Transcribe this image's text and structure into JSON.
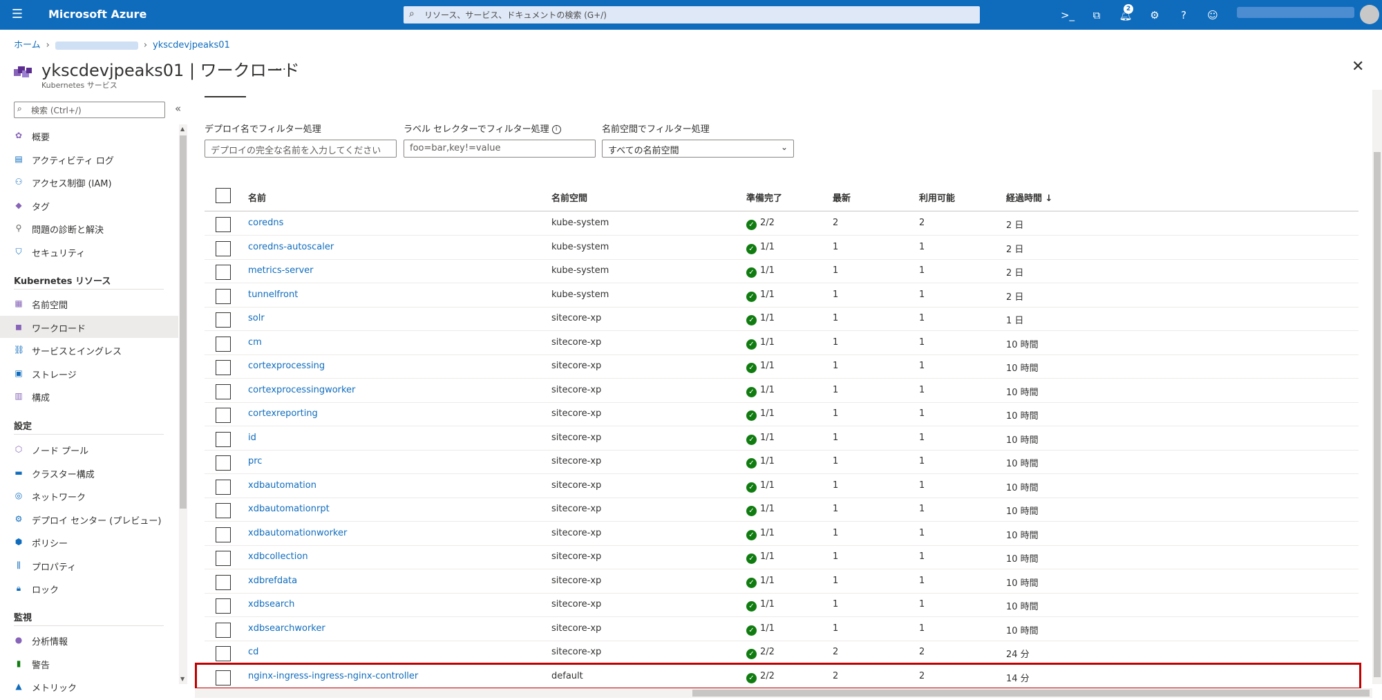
{
  "topbar": {
    "brand": "Microsoft Azure",
    "search_placeholder": "リソース、サービス、ドキュメントの検索 (G+/)",
    "notification_count": "2"
  },
  "breadcrumb": {
    "home": "ホーム",
    "current": "ykscdevjpeaks01"
  },
  "header": {
    "title": "ykscdevjpeaks01 | ワークロード",
    "subtitle": "Kubernetes サービス",
    "more": "…",
    "close": "✕"
  },
  "sidebar": {
    "search_placeholder": "検索 (Ctrl+/)",
    "collapse": "«",
    "items_top": [
      {
        "label": "概要",
        "icon": "overview-icon",
        "color": "#8764b8"
      },
      {
        "label": "アクティビティ ログ",
        "icon": "activity-log-icon",
        "color": "#0f6cbd"
      },
      {
        "label": "アクセス制御 (IAM)",
        "icon": "iam-icon",
        "color": "#0f6cbd"
      },
      {
        "label": "タグ",
        "icon": "tag-icon",
        "color": "#8764b8"
      },
      {
        "label": "問題の診断と解決",
        "icon": "wrench-icon",
        "color": "#605e5c"
      },
      {
        "label": "セキュリティ",
        "icon": "shield-icon",
        "color": "#0f6cbd"
      }
    ],
    "section_k8s": "Kubernetes リソース",
    "items_k8s": [
      {
        "label": "名前空間",
        "icon": "namespace-icon",
        "color": "#8764b8"
      },
      {
        "label": "ワークロード",
        "icon": "workload-icon",
        "color": "#8764b8",
        "selected": true
      },
      {
        "label": "サービスとイングレス",
        "icon": "services-icon",
        "color": "#0f6cbd"
      },
      {
        "label": "ストレージ",
        "icon": "storage-icon",
        "color": "#0f6cbd"
      },
      {
        "label": "構成",
        "icon": "config-icon",
        "color": "#8764b8"
      }
    ],
    "section_settings": "設定",
    "items_settings": [
      {
        "label": "ノード プール",
        "icon": "node-pool-icon",
        "color": "#8764b8"
      },
      {
        "label": "クラスター構成",
        "icon": "cluster-config-icon",
        "color": "#0f6cbd"
      },
      {
        "label": "ネットワーク",
        "icon": "network-icon",
        "color": "#0f6cbd"
      },
      {
        "label": "デプロイ センター (プレビュー)",
        "icon": "deploy-center-icon",
        "color": "#0f6cbd"
      },
      {
        "label": "ポリシー",
        "icon": "policy-icon",
        "color": "#0f6cbd"
      },
      {
        "label": "プロパティ",
        "icon": "properties-icon",
        "color": "#0f6cbd"
      },
      {
        "label": "ロック",
        "icon": "lock-icon",
        "color": "#0f6cbd"
      }
    ],
    "section_monitor": "監視",
    "items_monitor": [
      {
        "label": "分析情報",
        "icon": "insights-icon",
        "color": "#8764b8"
      },
      {
        "label": "警告",
        "icon": "alerts-icon",
        "color": "#107c10"
      },
      {
        "label": "メトリック",
        "icon": "metrics-icon",
        "color": "#0f6cbd"
      }
    ]
  },
  "filters": {
    "deploy_label": "デプロイ名でフィルター処理",
    "deploy_placeholder": "デプロイの完全な名前を入力してください",
    "label_label": "ラベル セレクターでフィルター処理",
    "label_placeholder": "foo=bar,key!=value",
    "ns_label": "名前空間でフィルター処理",
    "ns_value": "すべての名前空間"
  },
  "table": {
    "headers": {
      "name": "名前",
      "namespace": "名前空間",
      "ready": "準備完了",
      "latest": "最新",
      "available": "利用可能",
      "age": "経過時間 ↓"
    },
    "rows": [
      {
        "name": "coredns",
        "namespace": "kube-system",
        "ready": "2/2",
        "latest": "2",
        "available": "2",
        "age": "2 日"
      },
      {
        "name": "coredns-autoscaler",
        "namespace": "kube-system",
        "ready": "1/1",
        "latest": "1",
        "available": "1",
        "age": "2 日"
      },
      {
        "name": "metrics-server",
        "namespace": "kube-system",
        "ready": "1/1",
        "latest": "1",
        "available": "1",
        "age": "2 日"
      },
      {
        "name": "tunnelfront",
        "namespace": "kube-system",
        "ready": "1/1",
        "latest": "1",
        "available": "1",
        "age": "2 日"
      },
      {
        "name": "solr",
        "namespace": "sitecore-xp",
        "ready": "1/1",
        "latest": "1",
        "available": "1",
        "age": "1 日"
      },
      {
        "name": "cm",
        "namespace": "sitecore-xp",
        "ready": "1/1",
        "latest": "1",
        "available": "1",
        "age": "10 時間"
      },
      {
        "name": "cortexprocessing",
        "namespace": "sitecore-xp",
        "ready": "1/1",
        "latest": "1",
        "available": "1",
        "age": "10 時間"
      },
      {
        "name": "cortexprocessingworker",
        "namespace": "sitecore-xp",
        "ready": "1/1",
        "latest": "1",
        "available": "1",
        "age": "10 時間"
      },
      {
        "name": "cortexreporting",
        "namespace": "sitecore-xp",
        "ready": "1/1",
        "latest": "1",
        "available": "1",
        "age": "10 時間"
      },
      {
        "name": "id",
        "namespace": "sitecore-xp",
        "ready": "1/1",
        "latest": "1",
        "available": "1",
        "age": "10 時間"
      },
      {
        "name": "prc",
        "namespace": "sitecore-xp",
        "ready": "1/1",
        "latest": "1",
        "available": "1",
        "age": "10 時間"
      },
      {
        "name": "xdbautomation",
        "namespace": "sitecore-xp",
        "ready": "1/1",
        "latest": "1",
        "available": "1",
        "age": "10 時間"
      },
      {
        "name": "xdbautomationrpt",
        "namespace": "sitecore-xp",
        "ready": "1/1",
        "latest": "1",
        "available": "1",
        "age": "10 時間"
      },
      {
        "name": "xdbautomationworker",
        "namespace": "sitecore-xp",
        "ready": "1/1",
        "latest": "1",
        "available": "1",
        "age": "10 時間"
      },
      {
        "name": "xdbcollection",
        "namespace": "sitecore-xp",
        "ready": "1/1",
        "latest": "1",
        "available": "1",
        "age": "10 時間"
      },
      {
        "name": "xdbrefdata",
        "namespace": "sitecore-xp",
        "ready": "1/1",
        "latest": "1",
        "available": "1",
        "age": "10 時間"
      },
      {
        "name": "xdbsearch",
        "namespace": "sitecore-xp",
        "ready": "1/1",
        "latest": "1",
        "available": "1",
        "age": "10 時間"
      },
      {
        "name": "xdbsearchworker",
        "namespace": "sitecore-xp",
        "ready": "1/1",
        "latest": "1",
        "available": "1",
        "age": "10 時間"
      },
      {
        "name": "cd",
        "namespace": "sitecore-xp",
        "ready": "2/2",
        "latest": "2",
        "available": "2",
        "age": "24 分"
      },
      {
        "name": "nginx-ingress-ingress-nginx-controller",
        "namespace": "default",
        "ready": "2/2",
        "latest": "2",
        "available": "2",
        "age": "14 分",
        "highlighted": true
      }
    ]
  },
  "colors": {
    "accent": "#0f6cbd",
    "success": "#107c10",
    "highlight": "#c00000"
  }
}
